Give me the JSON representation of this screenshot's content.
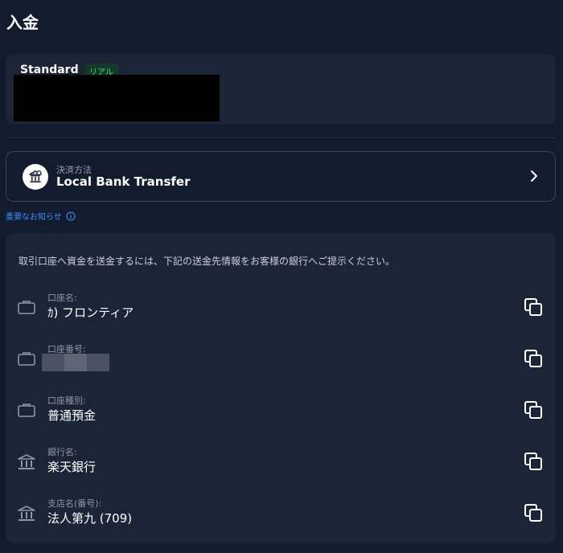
{
  "page": {
    "title": "入金"
  },
  "account": {
    "name": "Standard",
    "badge": "リアル"
  },
  "payment_method": {
    "label": "決済方法",
    "value": "Local Bank Transfer",
    "icon": "bank-building-icon"
  },
  "notice": {
    "text": "重要なお知らせ",
    "icon": "info-circle-icon"
  },
  "bank_info": {
    "description": "取引口座へ資金を送金するには、下記の送金先情報をお客様の銀行へご提示ください。",
    "rows": [
      {
        "label": "口座名:",
        "value": "ｶ) フロンティア",
        "icon": "briefcase-icon"
      },
      {
        "label": "口座番号:",
        "value": "",
        "icon": "briefcase-icon",
        "redacted": true
      },
      {
        "label": "口座種別:",
        "value": "普通預金",
        "icon": "briefcase-icon"
      },
      {
        "label": "銀行名:",
        "value": "楽天銀行",
        "icon": "bank-icon"
      },
      {
        "label": "支店名(番号):",
        "value": "法人第九 (709)",
        "icon": "bank-icon"
      }
    ]
  },
  "colors": {
    "background": "#131b2e",
    "card": "#1c2538",
    "accent_link": "#3d8bfd",
    "badge_bg": "#163828",
    "badge_text": "#3ddc84"
  }
}
